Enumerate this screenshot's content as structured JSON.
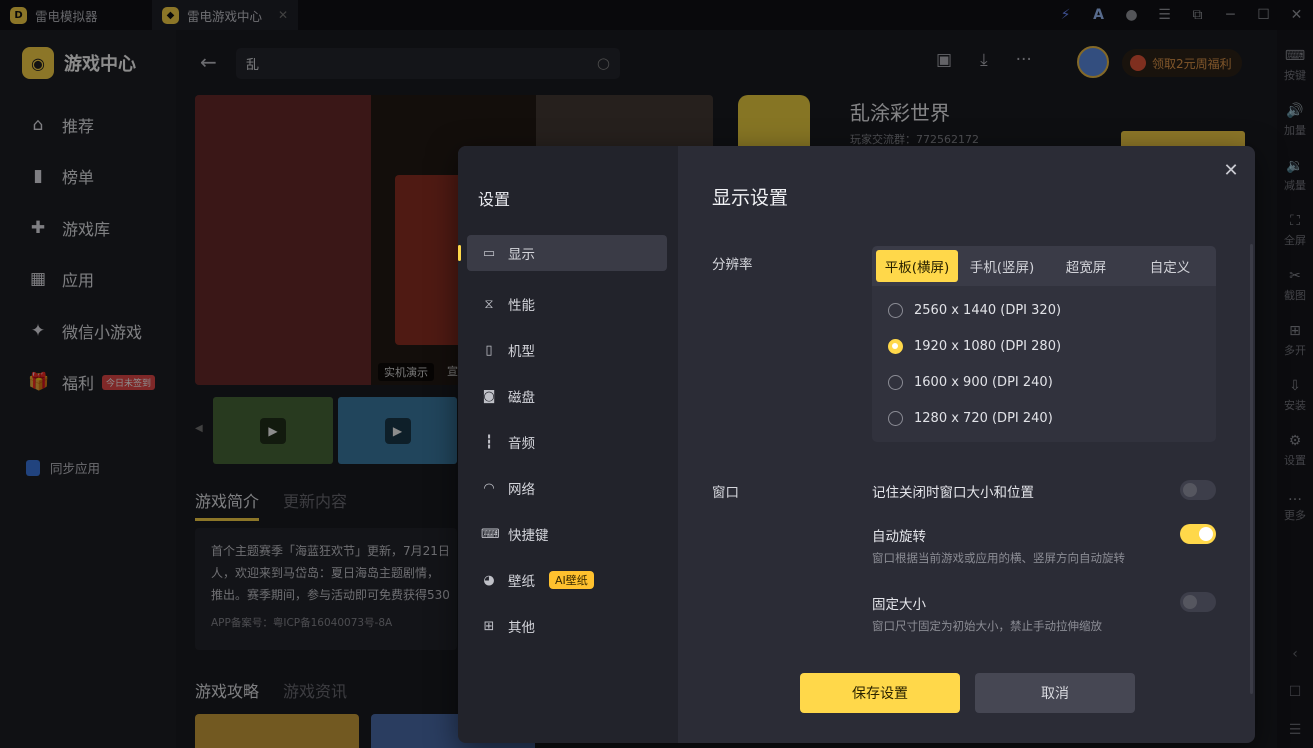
{
  "titlebar": {
    "tab1": "雷电模拟器",
    "tab2": "雷电游戏中心",
    "tab2_close": "✕"
  },
  "right_toolbar": {
    "items": [
      {
        "label": "按键",
        "icon": "keyboard-icon"
      },
      {
        "label": "加量",
        "icon": "volume-up-icon"
      },
      {
        "label": "减量",
        "icon": "volume-down-icon"
      },
      {
        "label": "全屏",
        "icon": "fullscreen-icon"
      },
      {
        "label": "截图",
        "icon": "scissors-icon"
      },
      {
        "label": "多开",
        "icon": "multi-instance-icon"
      },
      {
        "label": "安装",
        "icon": "install-icon"
      },
      {
        "label": "设置",
        "icon": "gear-icon"
      },
      {
        "label": "更多",
        "icon": "more-icon"
      }
    ]
  },
  "app": {
    "brand": "游戏中心",
    "nav": [
      {
        "label": "推荐",
        "icon": "home-icon"
      },
      {
        "label": "榜单",
        "icon": "chart-icon"
      },
      {
        "label": "游戏库",
        "icon": "gamepad-icon"
      },
      {
        "label": "应用",
        "icon": "apps-icon"
      },
      {
        "label": "微信小游戏",
        "icon": "wechat-game-icon"
      },
      {
        "label": "福利",
        "icon": "gift-icon"
      }
    ],
    "welfare_badge": "今日未签到",
    "sync": "同步应用"
  },
  "search": {
    "value": "乱"
  },
  "promo": "领取2元周福利",
  "hero": {
    "tag": "实机演示",
    "tag2": "宣"
  },
  "sections": {
    "intro_tab": "游戏简介",
    "update_tab": "更新内容",
    "intro_lines": [
      "首个主题赛季「海蓝狂欢节」更新，7月21日",
      "人，欢迎来到马岱岛：夏日海岛主题剧情，",
      "推出。赛季期间，参与活动即可免费获得530"
    ],
    "icp": "APP备案号：粤ICP备16040073号-8A",
    "guide_tab": "游戏攻略",
    "news_tab": "游戏资讯"
  },
  "game": {
    "title": "乱涂彩世界",
    "group": "玩家交流群：772562172"
  },
  "modal": {
    "side_title": "设置",
    "nav": [
      {
        "label": "显示",
        "icon": "monitor-icon"
      },
      {
        "label": "性能",
        "icon": "performance-icon"
      },
      {
        "label": "机型",
        "icon": "phone-icon"
      },
      {
        "label": "磁盘",
        "icon": "disk-icon"
      },
      {
        "label": "音频",
        "icon": "audio-icon"
      },
      {
        "label": "网络",
        "icon": "wifi-icon"
      },
      {
        "label": "快捷键",
        "icon": "keyboard-icon"
      },
      {
        "label": "壁纸",
        "icon": "palette-icon"
      },
      {
        "label": "其他",
        "icon": "grid-icon"
      }
    ],
    "wallpaper_badge": "AI壁纸",
    "title": "显示设置",
    "resolution_label": "分辨率",
    "resolution_tabs": [
      "平板(横屏)",
      "手机(竖屏)",
      "超宽屏",
      "自定义"
    ],
    "resolution_options": [
      "2560 x 1440  (DPI 320)",
      "1920 x 1080  (DPI 280)",
      "1600 x 900  (DPI 240)",
      "1280 x 720  (DPI 240)"
    ],
    "selected_resolution": "1920 x 1080  (DPI 280)",
    "window_label": "窗口",
    "remember_window": "记住关闭时窗口大小和位置",
    "auto_rotate": "自动旋转",
    "auto_rotate_desc": "窗口根据当前游戏或应用的横、竖屏方向自动旋转",
    "fixed_size": "固定大小",
    "fixed_size_desc": "窗口尺寸固定为初始大小，禁止手动拉伸缩放",
    "toggles": {
      "remember_window": false,
      "auto_rotate": true,
      "fixed_size": false
    },
    "save": "保存设置",
    "cancel": "取消"
  }
}
